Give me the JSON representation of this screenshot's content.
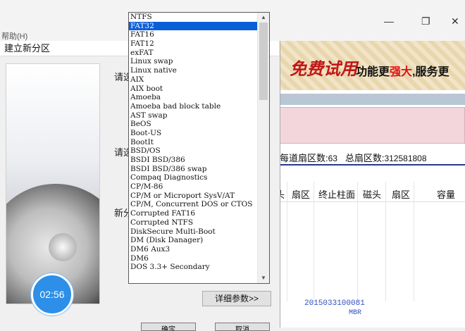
{
  "window": {
    "menu_fragment": "帮助(H)",
    "minimize_icon": "—",
    "maximize_icon": "❐",
    "close_icon": "✕"
  },
  "dialog": {
    "title": "建立新分区",
    "label_1": "请选",
    "label_2": "请选",
    "label_3": "新分",
    "detail_button": "详细参数>>",
    "ok_label": "确定",
    "cancel_label": "取消",
    "timer": "02:56"
  },
  "filesystem_list": {
    "selected": "FAT32",
    "items": [
      "NTFS",
      "FAT32",
      "FAT16",
      "FAT12",
      "exFAT",
      "Linux swap",
      "Linux native",
      "AIX",
      "AIX boot",
      "Amoeba",
      "Amoeba bad block table",
      "AST swap",
      "BeOS",
      "Boot-US",
      "BootIt",
      "BSD/OS",
      "BSDI BSD/386",
      "BSDI BSD/386 swap",
      "Compaq Diagnostics",
      "CP/M-86",
      "CP/M or Microport SysV/AT",
      "CP/M, Concurrent DOS or CTOS",
      "Corrupted FAT16",
      "Corrupted NTFS",
      "DiskSecure Multi-Boot",
      "DM (Disk Danager)",
      "DM6 Aux3",
      "DM6",
      "DOS 3.3+ Secondary"
    ]
  },
  "right_panel": {
    "banner_main": "免费试用",
    "banner_sub_1": "功能更",
    "banner_sub_hl": "强大",
    "banner_sub_2": ",服务更",
    "info_sectors_label": "每道扇区数:",
    "info_sectors_value": "63",
    "info_total_label": "总扇区数:",
    "info_total_value": "312581808",
    "columns": [
      "头",
      "扇区",
      "终止柱面",
      "磁头",
      "扇区",
      "容量"
    ],
    "serial": "2015033100081",
    "mbr": "MBR"
  }
}
